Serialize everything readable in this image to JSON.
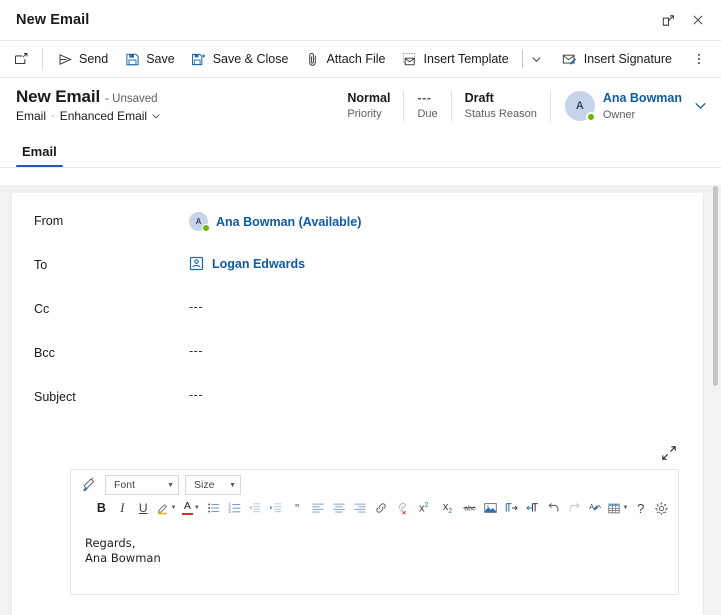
{
  "window": {
    "title": "New Email",
    "popout_icon": "popout-icon",
    "close_icon": "close-icon"
  },
  "commandbar": {
    "new_icon": "new-record-icon",
    "buttons": [
      {
        "label": "Send",
        "icon": "send-icon"
      },
      {
        "label": "Save",
        "icon": "save-icon"
      },
      {
        "label": "Save & Close",
        "icon": "save-and-close-icon"
      },
      {
        "label": "Attach File",
        "icon": "paperclip-icon"
      },
      {
        "label": "Insert Template",
        "icon": "insert-template-icon"
      },
      {
        "label": "Insert Signature",
        "icon": "insert-signature-icon"
      }
    ],
    "template_caret": "chevron-down-icon",
    "overflow": "more-commands-icon"
  },
  "record": {
    "title": "New Email",
    "unsaved": "- Unsaved",
    "entity": "Email",
    "separator": "·",
    "form_name": "Enhanced Email",
    "form_caret": "chevron-down-icon",
    "header_fields": [
      {
        "value": "Normal",
        "label": "Priority",
        "dim": false
      },
      {
        "value": "---",
        "label": "Due",
        "dim": true
      },
      {
        "value": "Draft",
        "label": "Status Reason",
        "dim": false
      }
    ],
    "owner": {
      "initial": "A",
      "name": "Ana Bowman",
      "role": "Owner",
      "presence": "available"
    }
  },
  "tabs": [
    {
      "label": "Email",
      "active": true
    }
  ],
  "form": {
    "expand_icon": "expand-editor-icon",
    "fields": [
      {
        "label": "From",
        "type": "person",
        "initial": "A",
        "value": "Ana Bowman (Available)",
        "presence": "available"
      },
      {
        "label": "To",
        "type": "contact",
        "icon": "contact-card-icon",
        "value": "Logan Edwards"
      },
      {
        "label": "Cc",
        "type": "empty",
        "value": "---"
      },
      {
        "label": "Bcc",
        "type": "empty",
        "value": "---"
      },
      {
        "label": "Subject",
        "type": "empty",
        "value": "---"
      }
    ]
  },
  "editor": {
    "format_painter_icon": "format-painter-icon",
    "font_select": {
      "value": "Font",
      "caret": "chevron-down-icon"
    },
    "size_select": {
      "value": "Size",
      "caret": "chevron-down-icon"
    },
    "tools": [
      {
        "name": "bold",
        "glyph": "B"
      },
      {
        "name": "italic",
        "glyph": "I"
      },
      {
        "name": "underline",
        "glyph": "U"
      },
      {
        "name": "highlight-color",
        "glyph": ""
      },
      {
        "name": "font-color",
        "glyph": "A"
      },
      {
        "name": "bulleted-list",
        "glyph": ""
      },
      {
        "name": "numbered-list",
        "glyph": ""
      },
      {
        "name": "decrease-indent",
        "glyph": ""
      },
      {
        "name": "increase-indent",
        "glyph": ""
      },
      {
        "name": "blockquote",
        "glyph": "”"
      },
      {
        "name": "align-left",
        "glyph": ""
      },
      {
        "name": "align-center",
        "glyph": ""
      },
      {
        "name": "align-right",
        "glyph": ""
      },
      {
        "name": "insert-link",
        "glyph": ""
      },
      {
        "name": "remove-link",
        "glyph": ""
      },
      {
        "name": "superscript",
        "glyph": "x²"
      },
      {
        "name": "subscript",
        "glyph": "x₂"
      },
      {
        "name": "strikethrough",
        "glyph": ""
      },
      {
        "name": "insert-image",
        "glyph": ""
      },
      {
        "name": "left-to-right",
        "glyph": ""
      },
      {
        "name": "right-to-left",
        "glyph": ""
      },
      {
        "name": "undo",
        "glyph": ""
      },
      {
        "name": "redo",
        "glyph": ""
      },
      {
        "name": "clear-formatting",
        "glyph": ""
      },
      {
        "name": "insert-table",
        "glyph": ""
      },
      {
        "name": "help",
        "glyph": "?"
      },
      {
        "name": "settings",
        "glyph": ""
      }
    ],
    "body": {
      "line1": "Regards,",
      "line2": "Ana Bowman"
    }
  },
  "colors": {
    "accent": "#185ABD",
    "link": "#0f5ba7",
    "presence_available": "#6bb700",
    "page_bg": "#f3f2f1",
    "border": "#edebe9"
  }
}
